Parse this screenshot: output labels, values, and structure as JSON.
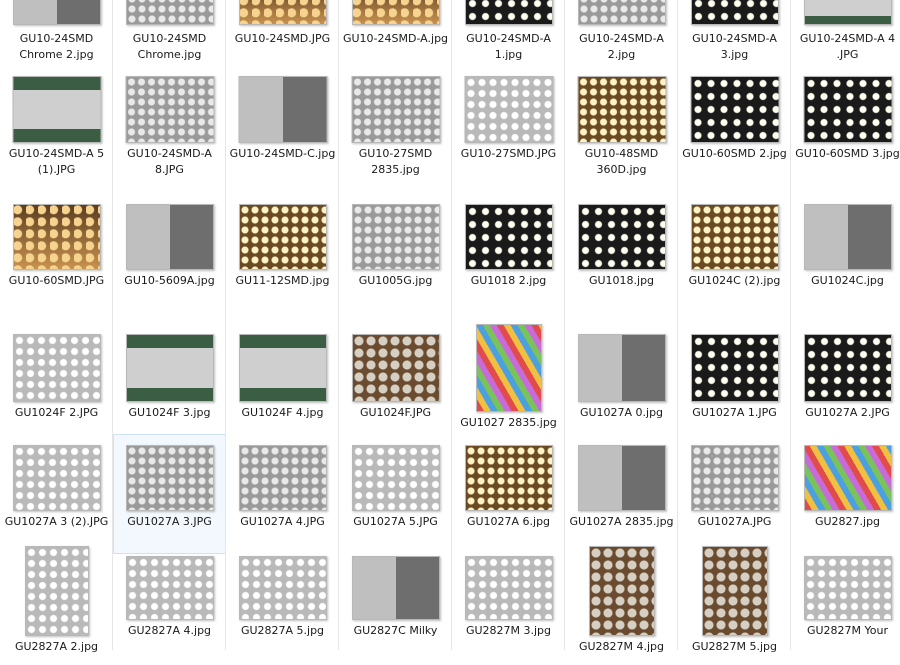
{
  "view": "large-icons",
  "selected_file": "GU1027A 3.JPG",
  "files": [
    {
      "name": "GU10-24SMD Chrome 2.jpg",
      "thumb": "mix"
    },
    {
      "name": "GU10-24SMD Chrome.jpg",
      "thumb": "grey"
    },
    {
      "name": "GU10-24SMD.JPG",
      "thumb": "warm"
    },
    {
      "name": "GU10-24SMD-A.jpg",
      "thumb": "warm"
    },
    {
      "name": "GU10-24SMD-A 1.jpg",
      "thumb": "night"
    },
    {
      "name": "GU10-24SMD-A 2.jpg",
      "thumb": "grey"
    },
    {
      "name": "GU10-24SMD-A 3.jpg",
      "thumb": "night"
    },
    {
      "name": "GU10-24SMD-A 4 .JPG",
      "thumb": "green"
    },
    {
      "name": "GU10-24SMD-A 5 (1).JPG",
      "thumb": "green"
    },
    {
      "name": "GU10-24SMD-A 8.JPG",
      "thumb": "grey"
    },
    {
      "name": "GU10-24SMD-C.jpg",
      "thumb": "mix"
    },
    {
      "name": "GU10-27SMD 2835.jpg",
      "thumb": "grey"
    },
    {
      "name": "GU10-27SMD.JPG",
      "thumb": "light"
    },
    {
      "name": "GU10-48SMD 360D.jpg",
      "thumb": "amber"
    },
    {
      "name": "GU10-60SMD 2.jpg",
      "thumb": "night"
    },
    {
      "name": "GU10-60SMD 3.jpg",
      "thumb": "night"
    },
    {
      "name": "GU10-60SMD.JPG",
      "thumb": "warm"
    },
    {
      "name": "GU10-5609A.jpg",
      "thumb": "mix"
    },
    {
      "name": "GU11-12SMD.jpg",
      "thumb": "amber"
    },
    {
      "name": "GU1005G.jpg",
      "thumb": "grey"
    },
    {
      "name": "GU1018 2.jpg",
      "thumb": "night"
    },
    {
      "name": "GU1018.jpg",
      "thumb": "night"
    },
    {
      "name": "GU1024C (2).jpg",
      "thumb": "amber"
    },
    {
      "name": "GU1024C.jpg",
      "thumb": "mix"
    },
    {
      "name": "GU1024F 2.JPG",
      "thumb": "light"
    },
    {
      "name": "GU1024F 3.jpg",
      "thumb": "green"
    },
    {
      "name": "GU1024F 4.jpg",
      "thumb": "green"
    },
    {
      "name": "GU1024F.JPG",
      "thumb": "brown"
    },
    {
      "name": "GU1027 2835.jpg",
      "thumb": "color"
    },
    {
      "name": "GU1027A 0.jpg",
      "thumb": "mix"
    },
    {
      "name": "GU1027A 1.JPG",
      "thumb": "night"
    },
    {
      "name": "GU1027A 2.JPG",
      "thumb": "night"
    },
    {
      "name": "GU1027A 3 (2).JPG",
      "thumb": "light"
    },
    {
      "name": "GU1027A 3.JPG",
      "thumb": "grey"
    },
    {
      "name": "GU1027A 4.JPG",
      "thumb": "grey"
    },
    {
      "name": "GU1027A 5.JPG",
      "thumb": "light"
    },
    {
      "name": "GU1027A 6.jpg",
      "thumb": "amber"
    },
    {
      "name": "GU1027A 2835.jpg",
      "thumb": "mix"
    },
    {
      "name": "GU1027A.JPG",
      "thumb": "grey"
    },
    {
      "name": "GU2827.jpg",
      "thumb": "color"
    },
    {
      "name": "GU2827A 2.jpg",
      "thumb": "light"
    },
    {
      "name": "GU2827A 4.jpg",
      "thumb": "light"
    },
    {
      "name": "GU2827A 5.jpg",
      "thumb": "light"
    },
    {
      "name": "GU2827C Milky",
      "thumb": "mix"
    },
    {
      "name": "GU2827M 3.jpg",
      "thumb": "light"
    },
    {
      "name": "GU2827M 4.jpg",
      "thumb": "brown"
    },
    {
      "name": "GU2827M 5.jpg",
      "thumb": "brown"
    },
    {
      "name": "GU2827M Your",
      "thumb": "light"
    }
  ]
}
